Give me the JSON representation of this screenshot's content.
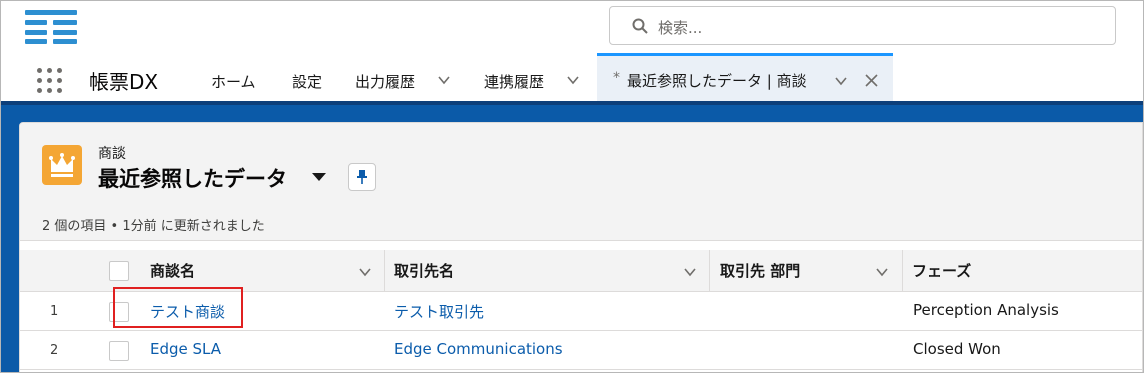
{
  "header": {
    "search_placeholder": "検索..."
  },
  "nav": {
    "app_name": "帳票DX",
    "items": [
      {
        "label": "ホーム"
      },
      {
        "label": "設定"
      },
      {
        "label": "出力履歴"
      },
      {
        "label": "連携履歴"
      }
    ],
    "active_tab": {
      "asterisk": "*",
      "label": "最近参照したデータ | 商談"
    }
  },
  "list_view": {
    "object_type": "商談",
    "name": "最近参照したデータ",
    "status": "2 個の項目 • 1分前 に更新されました"
  },
  "table": {
    "columns": [
      "商談名",
      "取引先名",
      "取引先 部門",
      "フェーズ"
    ],
    "rows": [
      {
        "num": "1",
        "opportunity": "テスト商談",
        "account": "テスト取引先",
        "division": "",
        "stage": "Perception Analysis"
      },
      {
        "num": "2",
        "opportunity": "Edge SLA",
        "account": "Edge Communications",
        "division": "",
        "stage": "Closed Won"
      }
    ]
  },
  "colors": {
    "brand_blue": "#0b5aa8",
    "link": "#0b5cab",
    "object_icon": "#f4a634",
    "highlight": "#e02020"
  }
}
